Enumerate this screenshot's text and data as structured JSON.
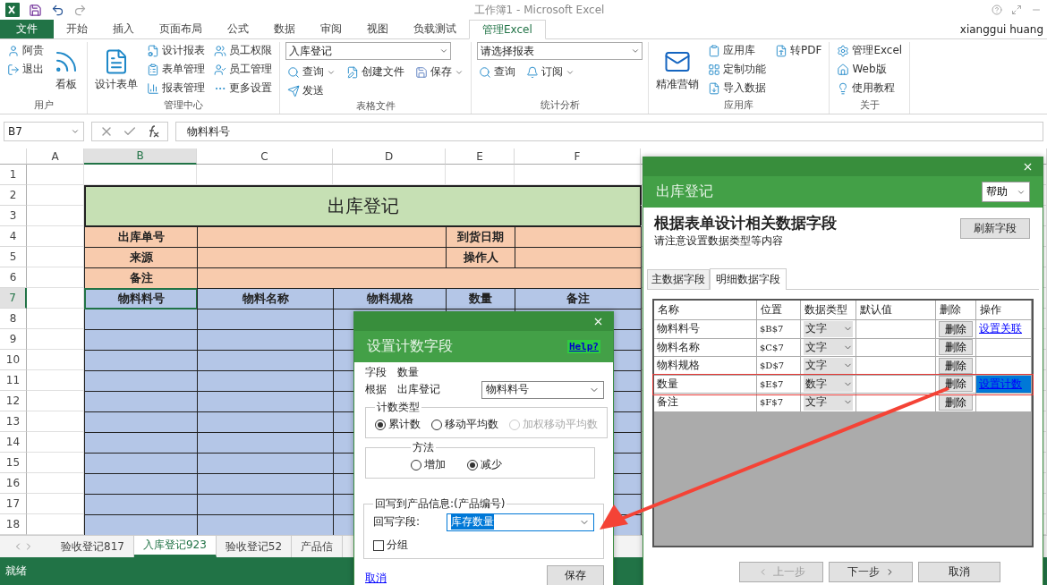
{
  "window_title": "工作簿1 - Microsoft Excel",
  "user": "xianggui huang",
  "ribbon_tabs": [
    {
      "label": "文件",
      "kind": "file",
      "selected": false
    },
    {
      "label": "开始",
      "kind": "tab",
      "selected": false
    },
    {
      "label": "插入",
      "kind": "tab",
      "selected": false
    },
    {
      "label": "页面布局",
      "kind": "tab",
      "selected": false
    },
    {
      "label": "公式",
      "kind": "tab",
      "selected": false
    },
    {
      "label": "数据",
      "kind": "tab",
      "selected": false
    },
    {
      "label": "审阅",
      "kind": "tab",
      "selected": false
    },
    {
      "label": "视图",
      "kind": "tab",
      "selected": false
    },
    {
      "label": "负载测试",
      "kind": "tab",
      "selected": false
    },
    {
      "label": "管理Excel",
      "kind": "tab",
      "selected": true
    }
  ],
  "ribbon_groups": [
    {
      "label": "用户",
      "kind": "buttons",
      "columns": [
        {
          "kind": "small",
          "items": [
            {
              "label": "阿贵"
            },
            {
              "label": "退出"
            }
          ]
        },
        {
          "kind": "large",
          "items": [
            {
              "label": "看板"
            }
          ]
        }
      ]
    },
    {
      "label": "管理中心",
      "kind": "buttons",
      "columns": [
        {
          "kind": "large",
          "items": [
            {
              "label": "设计表单"
            }
          ]
        },
        {
          "kind": "small",
          "items": [
            {
              "label": "设计报表"
            },
            {
              "label": "表单管理"
            },
            {
              "label": "报表管理"
            }
          ]
        },
        {
          "kind": "small",
          "items": [
            {
              "label": "员工权限"
            },
            {
              "label": "员工管理"
            },
            {
              "label": "更多设置"
            }
          ]
        }
      ]
    },
    {
      "label": "表格文件",
      "kind": "form",
      "combo": "入库登记",
      "rows": [
        [
          {
            "label": "查询",
            "dropdown": true
          },
          {
            "label": "创建文件",
            "dropdown": false
          },
          {
            "label": "保存",
            "dropdown": true
          }
        ],
        [
          {
            "label": "发送",
            "dropdown": false
          }
        ]
      ]
    },
    {
      "label": "统计分析",
      "kind": "form",
      "combo": "请选择报表",
      "rows": [
        [
          {
            "label": "查询",
            "dropdown": false
          },
          {
            "label": "订阅",
            "dropdown": true
          }
        ]
      ]
    },
    {
      "label": "应用库",
      "kind": "buttons",
      "columns": [
        {
          "kind": "large",
          "items": [
            {
              "label": "精准营销"
            }
          ]
        },
        {
          "kind": "small",
          "items": [
            {
              "label": "应用库"
            },
            {
              "label": "定制功能"
            },
            {
              "label": "导入数据"
            }
          ]
        },
        {
          "kind": "small",
          "items": [
            {
              "label": "转PDF"
            }
          ]
        }
      ]
    },
    {
      "label": "关于",
      "kind": "buttons",
      "columns": [
        {
          "kind": "small",
          "items": [
            {
              "label": "管理Excel"
            },
            {
              "label": "Web版"
            },
            {
              "label": "使用教程"
            }
          ]
        }
      ]
    }
  ],
  "formula_bar": {
    "name_box": "B7",
    "formula": "物料料号"
  },
  "sheet": {
    "columns": [
      {
        "label": "A",
        "selected": false
      },
      {
        "label": "B",
        "selected": true
      },
      {
        "label": "C",
        "selected": false
      },
      {
        "label": "D",
        "selected": false
      },
      {
        "label": "E",
        "selected": false
      },
      {
        "label": "F",
        "selected": false
      }
    ],
    "rows": [
      {
        "label": "1",
        "selected": false
      },
      {
        "label": "2",
        "selected": false
      },
      {
        "label": "3",
        "selected": false
      },
      {
        "label": "4",
        "selected": false
      },
      {
        "label": "5",
        "selected": false
      },
      {
        "label": "6",
        "selected": false
      },
      {
        "label": "7",
        "selected": true
      },
      {
        "label": "8",
        "selected": false
      },
      {
        "label": "9",
        "selected": false
      },
      {
        "label": "10",
        "selected": false
      },
      {
        "label": "11",
        "selected": false
      },
      {
        "label": "12",
        "selected": false
      },
      {
        "label": "13",
        "selected": false
      },
      {
        "label": "14",
        "selected": false
      },
      {
        "label": "15",
        "selected": false
      },
      {
        "label": "16",
        "selected": false
      },
      {
        "label": "17",
        "selected": false
      },
      {
        "label": "18",
        "selected": false
      }
    ],
    "title": "出库登记",
    "info_rows": [
      {
        "label": "出库单号",
        "label_2": "到货日期"
      },
      {
        "label": "来源",
        "label_2": "操作人"
      },
      {
        "label": "备注"
      }
    ],
    "header": [
      "物料料号",
      "物料名称",
      "物料规格",
      "数量",
      "备注"
    ]
  },
  "sheet_tabs": [
    {
      "label": "验收登记817",
      "selected": false
    },
    {
      "label": "入库登记923",
      "selected": true
    },
    {
      "label": "验收登记52",
      "selected": false
    },
    {
      "label": "产品信",
      "selected": false
    }
  ],
  "status": "就绪",
  "design_dialog": {
    "title": "出库登记",
    "help": "帮助",
    "heading": "根据表单设计相关数据字段",
    "subtitle": "请注意设置数据类型等内容",
    "refresh": "刷新字段",
    "tabs": [
      {
        "label": "主数据字段",
        "selected": false
      },
      {
        "label": "明细数据字段",
        "selected": true
      }
    ],
    "columns": [
      "名称",
      "位置",
      "数据类型",
      "默认值",
      "删除",
      "操作"
    ],
    "rows": [
      {
        "name": "物料料号",
        "position": "$B$7",
        "type": "文字",
        "delete": "删除",
        "action": "设置关联",
        "highlighted": false
      },
      {
        "name": "物料名称",
        "position": "$C$7",
        "type": "文字",
        "delete": "删除",
        "highlighted": false
      },
      {
        "name": "物料规格",
        "position": "$D$7",
        "type": "文字",
        "delete": "删除",
        "highlighted": false
      },
      {
        "name": "数量",
        "position": "$E$7",
        "type": "数字",
        "delete": "删除",
        "action": "设置计数",
        "highlighted": true
      },
      {
        "name": "备注",
        "position": "$F$7",
        "type": "文字",
        "delete": "删除",
        "highlighted": false
      }
    ],
    "footer": [
      {
        "label": "上一步",
        "kind": "prev",
        "disabled": true
      },
      {
        "label": "下一步",
        "kind": "next",
        "disabled": false
      },
      {
        "label": "取消",
        "kind": "plain",
        "disabled": false
      }
    ]
  },
  "count_dialog": {
    "title": "设置计数字段",
    "help": "Help?",
    "field_label": "字段",
    "field_value": "数量",
    "basis_label": "根据",
    "basis_value": "出库登记",
    "basis_select": "物料料号",
    "count_type": {
      "legend": "计数类型",
      "options": [
        {
          "label": "累计数",
          "selected": true,
          "disabled": false
        },
        {
          "label": "移动平均数",
          "selected": false,
          "disabled": false
        },
        {
          "label": "加权移动平均数",
          "selected": false,
          "disabled": true
        }
      ]
    },
    "method": {
      "legend": "方法",
      "options": [
        {
          "label": "增加",
          "selected": false,
          "disabled": false
        },
        {
          "label": "减少",
          "selected": true,
          "disabled": false
        }
      ]
    },
    "writeback": {
      "legend": "回写到产品信息:(产品编号)",
      "field_label": "回写字段:",
      "field_value": "库存数量",
      "group_label": "分组",
      "group_checked": false
    },
    "cancel": "取消",
    "save": "保存"
  }
}
